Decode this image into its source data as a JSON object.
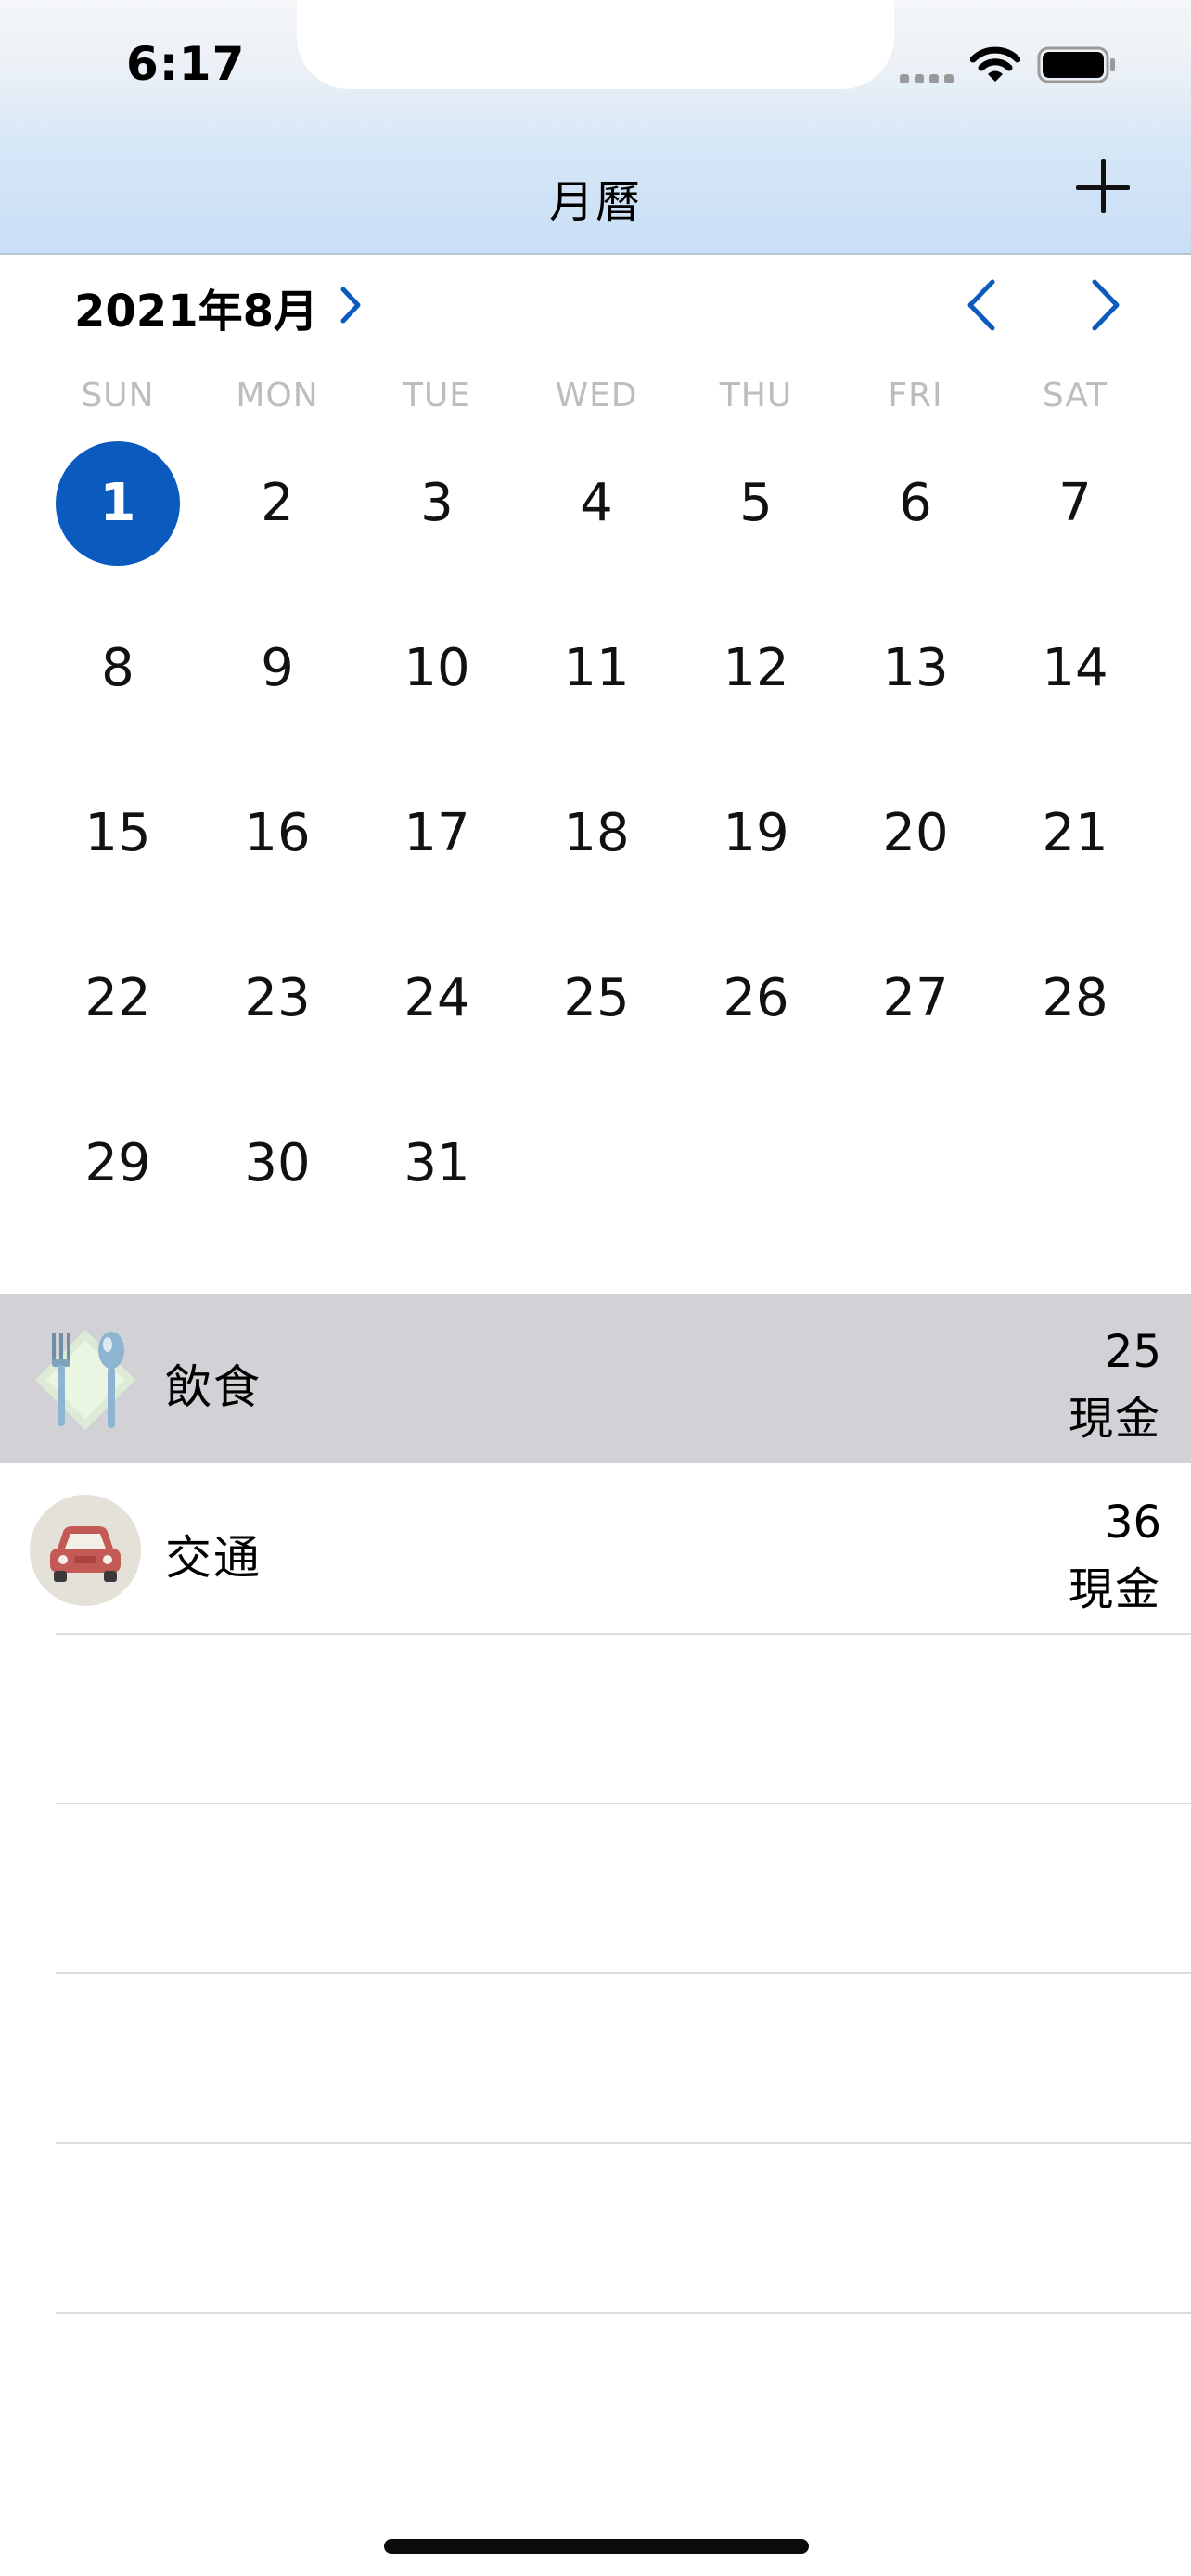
{
  "status_bar": {
    "time": "6:17"
  },
  "nav": {
    "title": "月曆",
    "add_icon": "plus-icon"
  },
  "calendar": {
    "month_label": "2021年8月",
    "selected_day": "1",
    "weekdays": [
      "SUN",
      "MON",
      "TUE",
      "WED",
      "THU",
      "FRI",
      "SAT"
    ],
    "days": [
      "1",
      "2",
      "3",
      "4",
      "5",
      "6",
      "7",
      "8",
      "9",
      "10",
      "11",
      "12",
      "13",
      "14",
      "15",
      "16",
      "17",
      "18",
      "19",
      "20",
      "21",
      "22",
      "23",
      "24",
      "25",
      "26",
      "27",
      "28",
      "29",
      "30",
      "31"
    ],
    "colors": {
      "accent": "#0a5bbd",
      "weekday": "#bdbdbd"
    }
  },
  "transactions": [
    {
      "category": "飲食",
      "amount": "25",
      "method": "現金",
      "icon": "dining-icon"
    },
    {
      "category": "交通",
      "amount": "36",
      "method": "現金",
      "icon": "car-icon"
    }
  ]
}
